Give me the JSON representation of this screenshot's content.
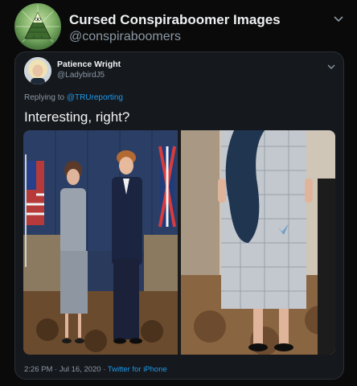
{
  "outer_tweet": {
    "display_name": "Cursed Conspiraboomer Images",
    "handle": "@conspiraboomers"
  },
  "quoted_tweet": {
    "display_name": "Patience Wright",
    "handle": "@LadybirdJ5",
    "replying_prefix": "Replying to ",
    "replying_to": "@TRUreporting",
    "text": "Interesting, right?",
    "timestamp": "2:26 PM · Jul 16, 2020 · ",
    "source": "Twitter for iPhone"
  },
  "colors": {
    "background": "#0a0a0a",
    "card": "#15181c",
    "link": "#1d9bf0",
    "muted": "#8b98a5"
  },
  "icons": {
    "outer_avatar": "illuminati-eye-pyramid-icon",
    "chevron": "chevron-down-icon"
  }
}
